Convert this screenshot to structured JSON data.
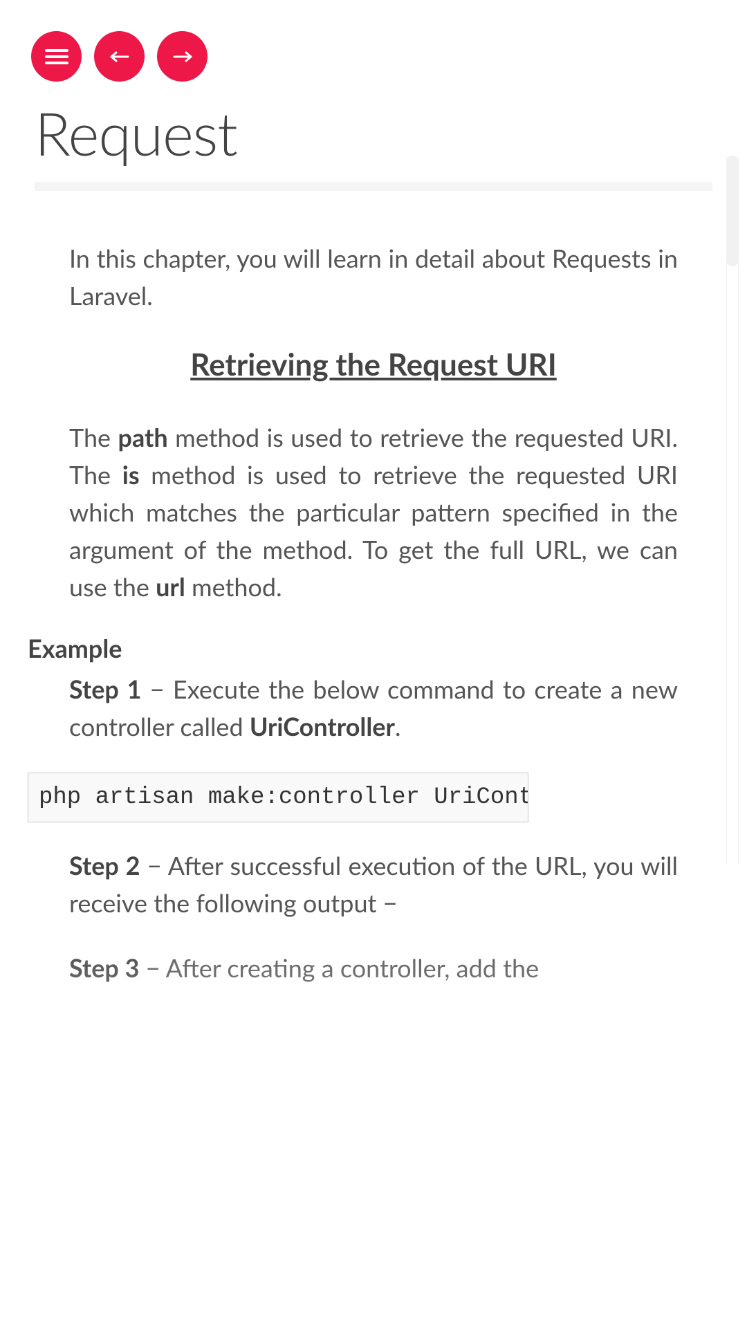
{
  "colors": {
    "accent": "#ed1848"
  },
  "nav": {
    "menu_icon": "menu-icon",
    "prev_icon": "arrow-left-icon",
    "next_icon": "arrow-right-icon"
  },
  "title": "Request",
  "intro": "In this chapter, you will learn in detail about Requests in Laravel.",
  "section_heading": "Retrieving the Request URI",
  "para_uri": {
    "t1": "The ",
    "b1": "path",
    "t2": " method is used to retrieve the requested URI. The ",
    "b2": "is",
    "t3": " method is used to retrieve the requested URI which matches the particular pattern specified in the argument of the method. To get the full URL, we can use the ",
    "b3": "url",
    "t4": " method."
  },
  "example_label": "Example",
  "step1": {
    "b": "Step 1",
    "t1": " − Execute the below command to create a new controller called ",
    "b2": "UriController",
    "t2": "."
  },
  "code1": "php artisan make:controller UriController –plain",
  "step2": {
    "b": "Step 2",
    "t": " − After successful execution of the URL, you will receive the following output −"
  },
  "step3": {
    "b": "Step 3",
    "t": " − After creating a controller, add the"
  }
}
